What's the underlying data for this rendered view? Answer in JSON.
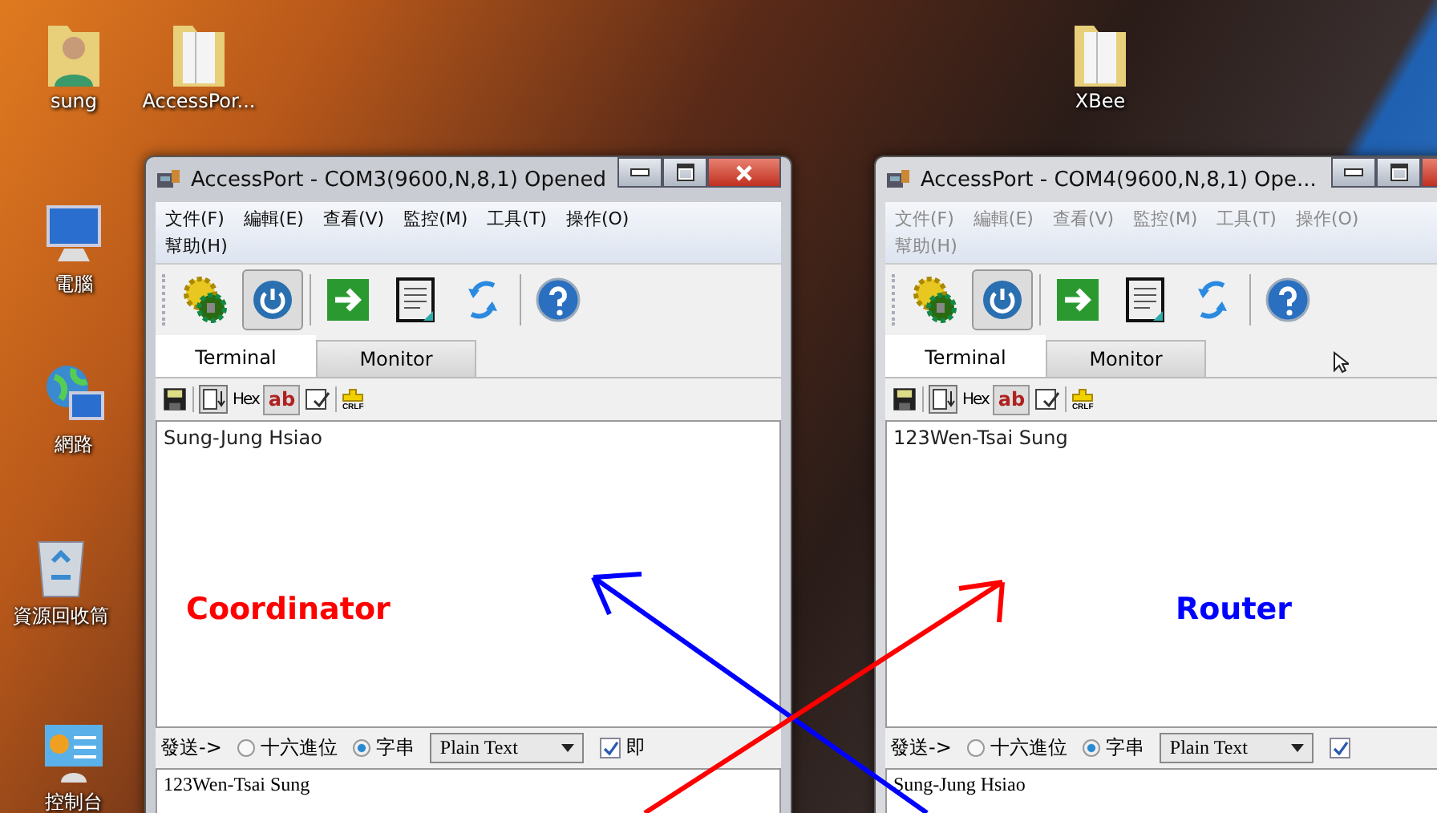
{
  "desktop_icons": [
    {
      "label": "sung",
      "kind": "user-folder"
    },
    {
      "label": "AccessPor...",
      "kind": "folder"
    },
    {
      "label": "電腦",
      "kind": "computer"
    },
    {
      "label": "網路",
      "kind": "network"
    },
    {
      "label": "資源回收筒",
      "kind": "recycle-bin"
    },
    {
      "label": "控制台",
      "kind": "control-panel"
    },
    {
      "label": "XBee",
      "kind": "folder"
    }
  ],
  "windows": [
    {
      "title": "AccessPort - COM3(9600,N,8,1) Opened",
      "active": true,
      "menu": [
        "文件(F)",
        "編輯(E)",
        "查看(V)",
        "監控(M)",
        "工具(T)",
        "操作(O)",
        "幫助(H)"
      ],
      "tabs": [
        {
          "label": "Terminal",
          "selected": true
        },
        {
          "label": "Monitor",
          "selected": false
        }
      ],
      "small_toolbar": {
        "hex_label": "Hex",
        "ab_label": "ab",
        "crlf_label": "CRLF"
      },
      "terminal_text": "Sung-Jung Hsiao",
      "annotation": {
        "text": "Coordinator",
        "color": "#ff0000"
      },
      "send": {
        "label": "發送->",
        "options": [
          {
            "label": "十六進位",
            "selected": false
          },
          {
            "label": "字串",
            "selected": true
          }
        ],
        "format": "Plain Text",
        "checkbox": {
          "label": "即",
          "checked": true
        }
      },
      "send_text": "123Wen-Tsai Sung"
    },
    {
      "title": "AccessPort - COM4(9600,N,8,1) Ope...",
      "active": false,
      "menu": [
        "文件(F)",
        "編輯(E)",
        "查看(V)",
        "監控(M)",
        "工具(T)",
        "操作(O)",
        "幫助(H)"
      ],
      "tabs": [
        {
          "label": "Terminal",
          "selected": true
        },
        {
          "label": "Monitor",
          "selected": false
        }
      ],
      "small_toolbar": {
        "hex_label": "Hex",
        "ab_label": "ab",
        "crlf_label": "CRLF"
      },
      "terminal_text": "123Wen-Tsai Sung",
      "annotation": {
        "text": "Router",
        "color": "#0000ff"
      },
      "send": {
        "label": "發送->",
        "options": [
          {
            "label": "十六進位",
            "selected": false
          },
          {
            "label": "字串",
            "selected": true
          }
        ],
        "format": "Plain Text",
        "checkbox": {
          "checked": true
        }
      },
      "send_text": "Sung-Jung Hsiao"
    }
  ]
}
